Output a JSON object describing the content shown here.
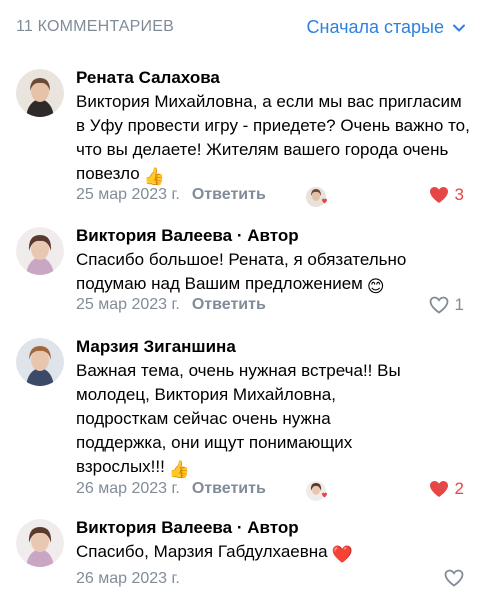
{
  "header": {
    "count_label": "11 КОММЕНТАРИЕВ",
    "sort_label": "Сначала старые",
    "sort_icon": "chevron-down-icon"
  },
  "colors": {
    "accent": "#2d81e0",
    "secondary_text": "#818c99",
    "like_red": "#e64646"
  },
  "comments": [
    {
      "author": "Рената Салахова",
      "author_badge": "",
      "text": "Виктория Михайловна, а если мы вас пригласим в Уфу провести игру - приедете? Очень важно то, что вы делаете! Жителям вашего города очень повезло",
      "emoji": "👍",
      "date": "25 мар 2023 г.",
      "reply_label": "Ответить",
      "likes": "3",
      "liked": true
    },
    {
      "author": "Виктория Валеева",
      "author_badge": "· Автор",
      "text": "Спасибо большое! Рената, я обязательно подумаю над Вашим предложением",
      "emoji": "😊",
      "date": "25 мар 2023 г.",
      "reply_label": "Ответить",
      "likes": "1",
      "liked": false
    },
    {
      "author": "Марзия Зиганшина",
      "author_badge": "",
      "text": "Важная тема, очень нужная встреча!! Вы молодец, Виктория Михайловна, подросткам сейчас очень нужна поддержка, они ищут понимающих взрослых!!!",
      "emoji": "👍",
      "date": "26 мар 2023 г.",
      "reply_label": "Ответить",
      "likes": "2",
      "liked": true
    },
    {
      "author": "Виктория Валеева",
      "author_badge": "· Автор",
      "text": "Спасибо, Марзия Габдулхаевна",
      "emoji": "❤️",
      "date": "26 мар 2023 г.",
      "reply_label": "",
      "likes": "",
      "liked": false
    }
  ]
}
